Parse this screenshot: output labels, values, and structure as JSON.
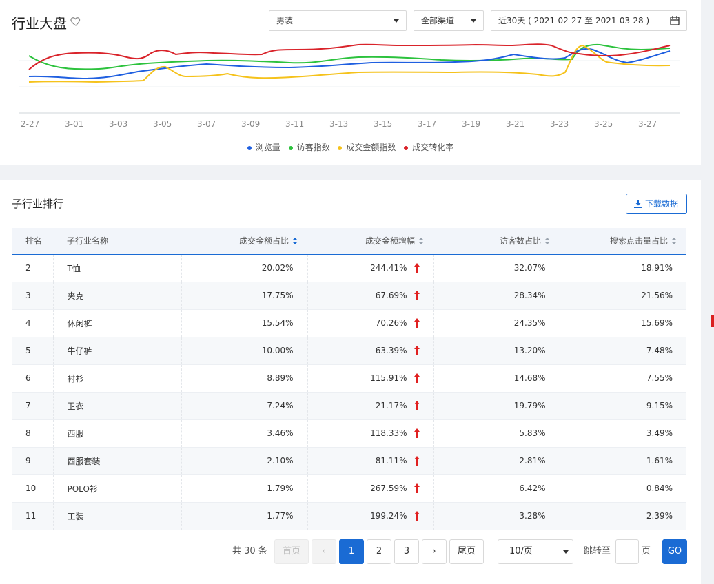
{
  "header": {
    "title": "行业大盘",
    "gender_select": "男装",
    "channel_select": "全部渠道",
    "date_range": "近30天 ( 2021-02-27 至 2021-03-28 )"
  },
  "chart_data": {
    "type": "line",
    "x": [
      "2-27",
      "3-01",
      "3-03",
      "3-05",
      "3-07",
      "3-09",
      "3-11",
      "3-13",
      "3-15",
      "3-17",
      "3-19",
      "3-21",
      "3-23",
      "3-25",
      "3-27"
    ],
    "legend": [
      "浏览量",
      "访客指数",
      "成交金额指数",
      "成交转化率"
    ],
    "colors": [
      "#1f5fe0",
      "#2cc23d",
      "#f5c21b",
      "#d9232a"
    ]
  },
  "ranking": {
    "title": "子行业排行",
    "download_label": "下载数据",
    "columns": [
      "排名",
      "子行业名称",
      "成交金额占比",
      "成交金额增幅",
      "访客数占比",
      "搜索点击量占比"
    ],
    "rows": [
      {
        "rank": "2",
        "name": "T恤",
        "amount": "20.02%",
        "growth": "244.41%",
        "visitors": "32.07%",
        "search": "18.91%"
      },
      {
        "rank": "3",
        "name": "夹克",
        "amount": "17.75%",
        "growth": "67.69%",
        "visitors": "28.34%",
        "search": "21.56%"
      },
      {
        "rank": "4",
        "name": "休闲裤",
        "amount": "15.54%",
        "growth": "70.26%",
        "visitors": "24.35%",
        "search": "15.69%"
      },
      {
        "rank": "5",
        "name": "牛仔裤",
        "amount": "10.00%",
        "growth": "63.39%",
        "visitors": "13.20%",
        "search": "7.48%"
      },
      {
        "rank": "6",
        "name": "衬衫",
        "amount": "8.89%",
        "growth": "115.91%",
        "visitors": "14.68%",
        "search": "7.55%"
      },
      {
        "rank": "7",
        "name": "卫衣",
        "amount": "7.24%",
        "growth": "21.17%",
        "visitors": "19.79%",
        "search": "9.15%"
      },
      {
        "rank": "8",
        "name": "西服",
        "amount": "3.46%",
        "growth": "118.33%",
        "visitors": "5.83%",
        "search": "3.49%"
      },
      {
        "rank": "9",
        "name": "西服套装",
        "amount": "2.10%",
        "growth": "81.11%",
        "visitors": "2.81%",
        "search": "1.61%"
      },
      {
        "rank": "10",
        "name": "POLO衫",
        "amount": "1.79%",
        "growth": "267.59%",
        "visitors": "6.42%",
        "search": "0.84%"
      },
      {
        "rank": "11",
        "name": "工装",
        "amount": "1.77%",
        "growth": "199.24%",
        "visitors": "3.28%",
        "search": "2.39%"
      }
    ]
  },
  "pagination": {
    "total": "共 30 条",
    "first": "首页",
    "prev": "‹",
    "pages": [
      "1",
      "2",
      "3"
    ],
    "next": "›",
    "last": "尾页",
    "page_size": "10/页",
    "jump_label": "跳转至",
    "page_unit": "页",
    "go": "GO"
  }
}
